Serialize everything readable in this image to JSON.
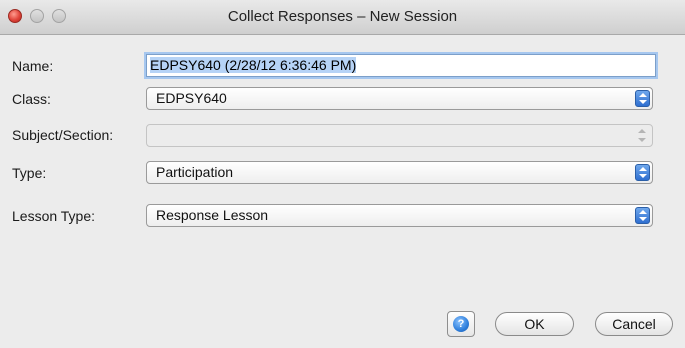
{
  "window": {
    "title": "Collect Responses – New Session"
  },
  "form": {
    "name_label": "Name:",
    "name_value": "EDPSY640 (2/28/12 6:36:46 PM)",
    "class_label": "Class:",
    "class_value": "EDPSY640",
    "subject_label": "Subject/Section:",
    "subject_value": "",
    "type_label": "Type:",
    "type_value": "Participation",
    "lesson_type_label": "Lesson Type:",
    "lesson_type_value": "Response Lesson"
  },
  "buttons": {
    "help_icon": "?",
    "ok_label": "OK",
    "cancel_label": "Cancel"
  },
  "icons": {
    "close": "close-icon",
    "minimize": "minimize-icon",
    "zoom": "zoom-icon",
    "help": "help-icon",
    "select_arrows": "chevron-up-down-icon"
  },
  "colors": {
    "selection": "#b6d3f6",
    "focus_ring": "#a6c7ef",
    "select_arrows": "#2f6fd0",
    "close_button": "#e0443a"
  }
}
